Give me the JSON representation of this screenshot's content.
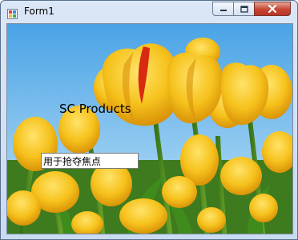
{
  "window": {
    "title": "Form1",
    "icon": "form-app-icon",
    "controls": [
      "minimize-icon",
      "maximize-icon",
      "close-icon"
    ]
  },
  "main": {
    "background_image": "yellow-tulips-photo",
    "label_text": "SC Products",
    "textbox_value": "用于抢夺焦点"
  }
}
